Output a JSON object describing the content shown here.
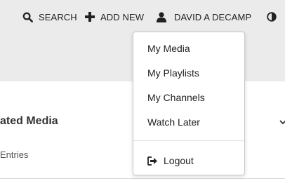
{
  "header": {
    "search_label": "SEARCH",
    "add_new_label": "ADD NEW",
    "user_label": "DAVID A DECAMP",
    "icons": {
      "search": "search-icon",
      "add": "plus-icon",
      "user": "user-icon",
      "contrast": "contrast-icon"
    }
  },
  "user_menu": {
    "items": [
      {
        "label": "My Media"
      },
      {
        "label": "My Playlists"
      },
      {
        "label": "My Channels"
      },
      {
        "label": "Watch Later"
      }
    ],
    "logout_label": "Logout",
    "logout_icon": "logout-icon"
  },
  "main": {
    "section_title": "ated Media",
    "section_subtitle": "Entries",
    "chevron_icon": "chevron-down-icon"
  },
  "colors": {
    "header_background": "#ebebeb",
    "menu_border": "#c8c8c8",
    "text": "#222222"
  }
}
